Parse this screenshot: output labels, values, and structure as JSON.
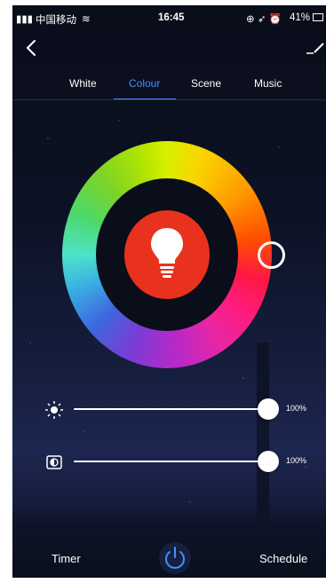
{
  "status_bar": {
    "signal": "中国移动",
    "time": "16:45",
    "battery": "41%"
  },
  "tabs": [
    {
      "label": "White",
      "active": false
    },
    {
      "label": "Colour",
      "active": true
    },
    {
      "label": "Scene",
      "active": false
    },
    {
      "label": "Music",
      "active": false
    }
  ],
  "color_wheel": {
    "center_icon": "lightbulb-icon",
    "center_color": "#e8321e",
    "picker_color": "#ff1744"
  },
  "brightness": {
    "icon": "sun-icon",
    "value_label": "100%",
    "value": 1.0
  },
  "saturation": {
    "icon": "contrast-icon",
    "value_label": "100%",
    "value": 1.0
  },
  "bottom_bar": {
    "timer_label": "Timer",
    "schedule_label": "Schedule",
    "power_icon": "power-icon"
  },
  "colors": {
    "accent": "#4a8cff",
    "background": "#0c1224"
  }
}
